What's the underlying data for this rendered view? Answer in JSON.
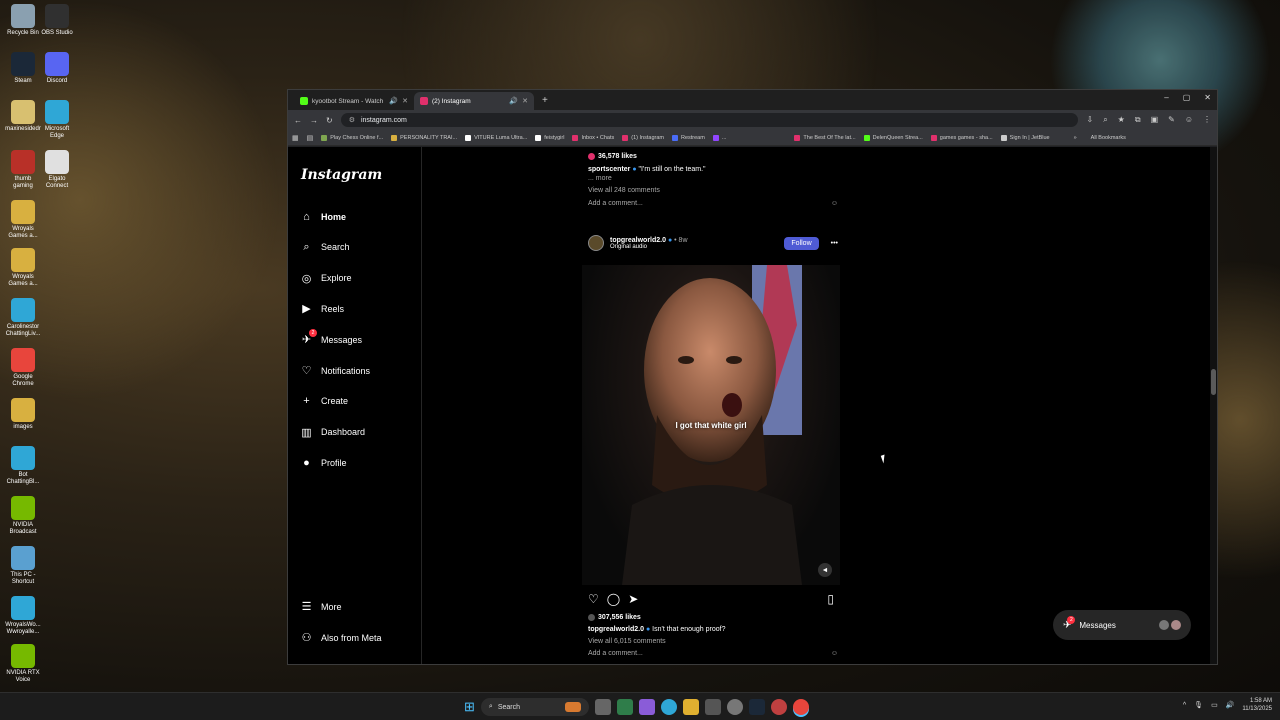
{
  "desktop": {
    "icons": [
      {
        "label": "Recycle Bin",
        "color": "#8aa0b0"
      },
      {
        "label": "OBS Studio",
        "color": "#303030"
      },
      {
        "label": "Steam",
        "color": "#1b2838"
      },
      {
        "label": "Discord",
        "color": "#5865f2"
      },
      {
        "label": "maxinesidedr",
        "color": "#d8c070"
      },
      {
        "label": "Microsoft Edge",
        "color": "#2fa7d6"
      },
      {
        "label": "thumb gaming",
        "color": "#b83028"
      },
      {
        "label": "Elgato Connect",
        "color": "#e0e0e0"
      },
      {
        "label": "Wroyals Games a...",
        "color": "#d8b040"
      },
      {
        "label": "Wroyals Games a...",
        "color": "#d8b040"
      },
      {
        "label": "Carolinestor ChattingLiv...",
        "color": "#2fa7d6"
      },
      {
        "label": "Google Chrome",
        "color": "#e8453c"
      },
      {
        "label": "images",
        "color": "#d8b040"
      },
      {
        "label": "Bot ChattingBl...",
        "color": "#2fa7d6"
      },
      {
        "label": "NVIDIA Broadcast",
        "color": "#76b900"
      },
      {
        "label": "This PC - Shortcut",
        "color": "#5aa0d0"
      },
      {
        "label": "WroyalsWo... Wwroyalle...",
        "color": "#2fa7d6"
      },
      {
        "label": "NVIDIA RTX Voice",
        "color": "#76b900"
      }
    ]
  },
  "browser": {
    "tabs": [
      {
        "title": "kyootbot Stream - Watch L",
        "favicon_color": "#53fc18"
      },
      {
        "title": "(2) Instagram",
        "favicon_color": "#e1306c"
      }
    ],
    "new_tab": "+",
    "window_controls": {
      "minimize": "–",
      "maximize": "▢",
      "close": "✕"
    },
    "url": "instagram.com",
    "bookmarks": [
      {
        "label": "Play Chess Online f...",
        "color": "#7fa650"
      },
      {
        "label": "PERSONALITY TRAI...",
        "color": "#d8b040"
      },
      {
        "label": "VITURE Luma Ultra...",
        "color": "#ffffff"
      },
      {
        "label": "feistygirl",
        "color": "#ffffff"
      },
      {
        "label": "Inbox • Chats",
        "color": "#e1306c"
      },
      {
        "label": "(1) Instagram",
        "color": "#e1306c"
      },
      {
        "label": "Restream",
        "color": "#4a6cf7"
      },
      {
        "label": "...",
        "color": "#9146ff"
      },
      {
        "label": "The Best Of The lat...",
        "color": "#e1306c"
      },
      {
        "label": "DelenQueen Strea...",
        "color": "#53fc18"
      },
      {
        "label": "games games - sha...",
        "color": "#e1306c"
      },
      {
        "label": "Sign In | JetBlue",
        "color": "#cccccc"
      }
    ],
    "bookmarks_overflow": "»",
    "all_bookmarks": "All Bookmarks"
  },
  "instagram": {
    "logo": "Instagram",
    "nav": [
      {
        "label": "Home",
        "icon": "⌂"
      },
      {
        "label": "Search",
        "icon": "⌕"
      },
      {
        "label": "Explore",
        "icon": "◎"
      },
      {
        "label": "Reels",
        "icon": "▶"
      },
      {
        "label": "Messages",
        "icon": "✈",
        "badge": "2"
      },
      {
        "label": "Notifications",
        "icon": "♡"
      },
      {
        "label": "Create",
        "icon": "+"
      },
      {
        "label": "Dashboard",
        "icon": "▥"
      },
      {
        "label": "Profile",
        "icon": "●"
      }
    ],
    "more": "More",
    "also_from_meta": "Also from Meta",
    "prev_post": {
      "likes": "36,578 likes",
      "username": "sportscenter",
      "caption": "\"I'm still on the team.\"",
      "more": "... more",
      "view_comments": "View all 248 comments",
      "add_comment": "Add a comment..."
    },
    "post": {
      "username": "topgrealworld2.0",
      "time": "• 8w",
      "audio": "Original audio",
      "follow": "Follow",
      "options": "•••",
      "subtitle": "I got that white girl",
      "likes": "307,556 likes",
      "caption_user": "topgrealworld2.0",
      "caption": "Isn't that enough proof?",
      "view_comments": "View all 6,015 comments",
      "add_comment": "Add a comment...",
      "sound_icon": "🔈"
    },
    "messages_pill": {
      "label": "Messages",
      "badge": "2"
    }
  },
  "taskbar": {
    "search_placeholder": "Search",
    "clock_time": "1:58 AM",
    "clock_date": "11/13/2025",
    "tray_overflow": "^"
  }
}
